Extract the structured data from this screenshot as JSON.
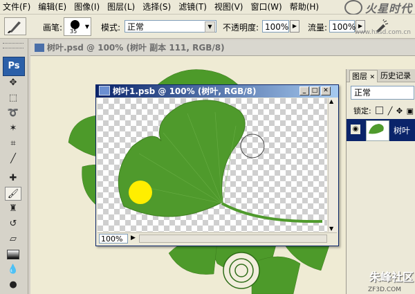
{
  "menubar": {
    "items": [
      "文件(F)",
      "编辑(E)",
      "图像(I)",
      "图层(L)",
      "选择(S)",
      "滤镜(T)",
      "视图(V)",
      "窗口(W)",
      "帮助(H)"
    ]
  },
  "brand": {
    "text": "火星时代",
    "url": "www.hxsd.com.cn"
  },
  "options": {
    "brush_label": "画笔:",
    "brush_size": "35",
    "mode_label": "模式:",
    "mode_value": "正常",
    "opacity_label": "不透明度:",
    "opacity_value": "100%",
    "flow_label": "流量:",
    "flow_value": "100%"
  },
  "toolbox": {
    "logo": "Ps",
    "tools": [
      "move-icon",
      "marquee-icon",
      "lasso-icon",
      "magic-wand-icon",
      "crop-icon",
      "eyedropper-icon",
      "healing-icon",
      "brush-icon",
      "stamp-icon",
      "history-brush-icon",
      "eraser-icon",
      "gradient-icon",
      "blur-icon"
    ]
  },
  "background_document": {
    "title": "树叶.psd @ 100% (树叶 副本 111, RGB/8)"
  },
  "document_window": {
    "title": "树叶1.psb @ 100% (树叶, RGB/8)",
    "zoom": "100%"
  },
  "layers_panel": {
    "tab_layers": "图层",
    "tab_history": "历史记录",
    "blend_mode": "正常",
    "lock_label": "锁定:",
    "layer_name": "树叶"
  },
  "watermark": {
    "text": "朱峰社区",
    "sub": "ZF3D.COM"
  },
  "colors": {
    "title_active": "#0a246a",
    "leaf": "#4f9a2c",
    "brush_cursor": "#ffee00"
  }
}
